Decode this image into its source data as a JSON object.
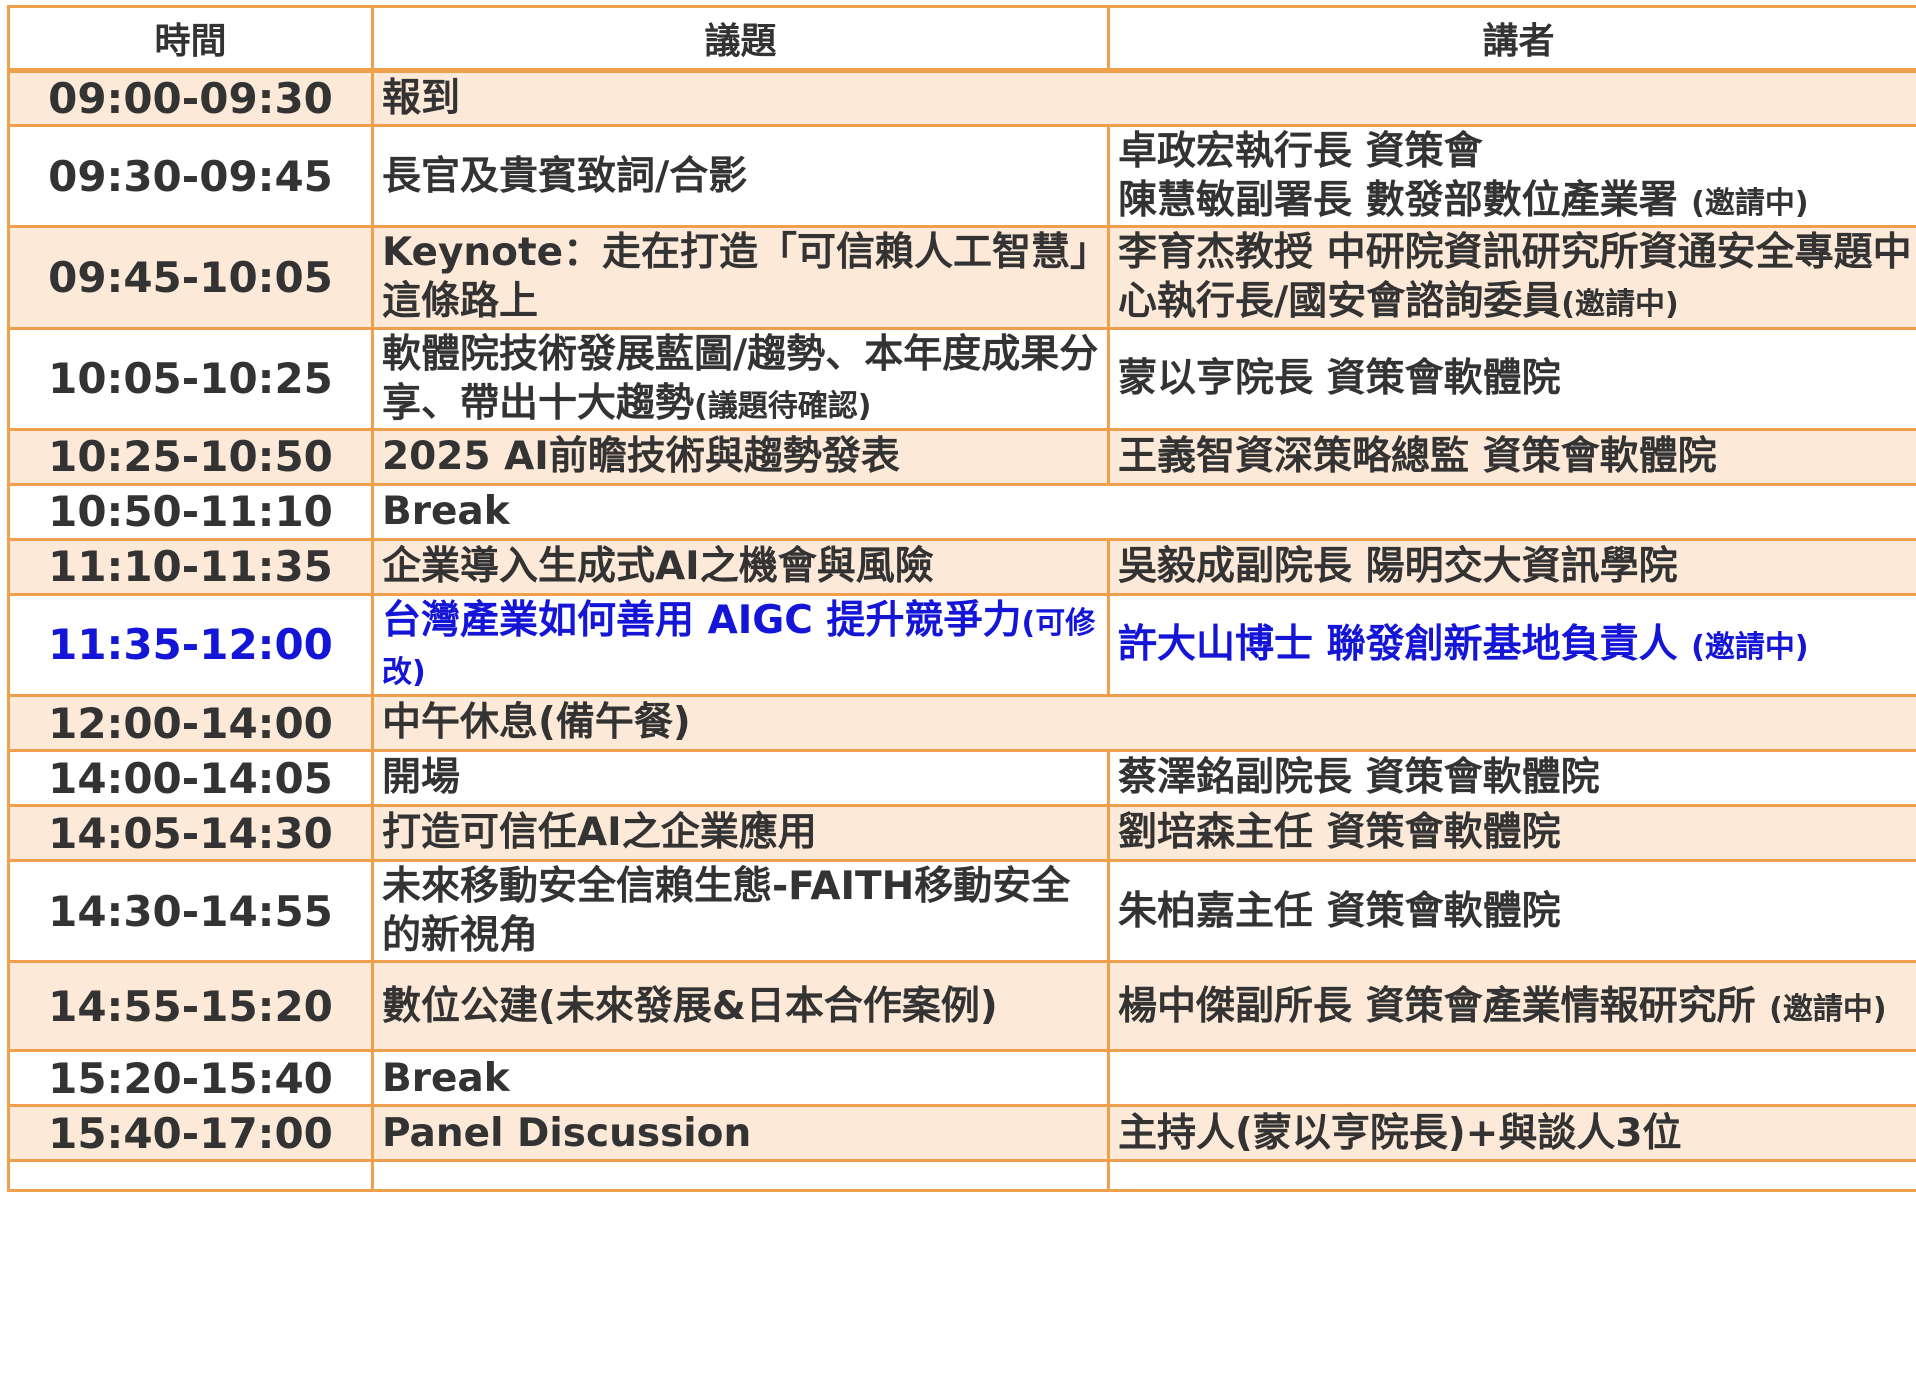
{
  "header": {
    "time": "時間",
    "topic": "議題",
    "speaker": "講者"
  },
  "rows": [
    {
      "time": "09:00-09:30",
      "topic": "報到",
      "speaker": []
    },
    {
      "time": "09:30-09:45",
      "topic": "長官及貴賓致詞/合影",
      "speaker": [
        {
          "text": "卓政宏執行長 資策會",
          "note": ""
        },
        {
          "text": "陳慧敏副署長 數發部數位產業署 ",
          "note": "(邀請中)"
        }
      ]
    },
    {
      "time": "09:45-10:05",
      "topic": "Keynote：走在打造「可信賴人工智慧」這條路上",
      "speaker": [
        {
          "text": "李育杰教授 中研院資訊研究所資通安全專題中心執行長/國安會諮詢委員",
          "note": "(邀請中)"
        }
      ]
    },
    {
      "time": "10:05-10:25",
      "topic": "軟體院技術發展藍圖/趨勢、本年度成果分享、帶出十大趨勢",
      "topic_note": "(議題待確認)",
      "speaker": [
        {
          "text": "蒙以亨院長 資策會軟體院",
          "note": ""
        }
      ]
    },
    {
      "time": "10:25-10:50",
      "topic": "2025 AI前瞻技術與趨勢發表",
      "speaker": [
        {
          "text": "王義智資深策略總監 資策會軟體院",
          "note": ""
        }
      ]
    },
    {
      "time": "10:50-11:10",
      "topic": "Break",
      "speaker": []
    },
    {
      "time": "11:10-11:35",
      "topic": "企業導入生成式AI之機會與風險",
      "speaker": [
        {
          "text": "吳毅成副院長 陽明交大資訊學院",
          "note": ""
        }
      ]
    },
    {
      "time": "11:35-12:00",
      "topic": "台灣產業如何善用 AIGC 提升競爭力",
      "topic_note": "(可修改)",
      "speaker": [
        {
          "text": "許大山博士 聯發創新基地負責人 ",
          "note": "(邀請中)"
        }
      ]
    },
    {
      "time": "12:00-14:00",
      "topic": "中午休息(備午餐)",
      "speaker": []
    },
    {
      "time": "14:00-14:05",
      "topic": "開場",
      "speaker": [
        {
          "text": "蔡澤銘副院長 資策會軟體院",
          "note": ""
        }
      ]
    },
    {
      "time": "14:05-14:30",
      "topic": "打造可信任AI之企業應用",
      "speaker": [
        {
          "text": "劉培森主任 資策會軟體院",
          "note": ""
        }
      ]
    },
    {
      "time": "14:30-14:55",
      "topic": "未來移動安全信賴生態-FAITH移動安全的新視角",
      "speaker": [
        {
          "text": "朱柏嘉主任 資策會軟體院",
          "note": ""
        }
      ]
    },
    {
      "time": "14:55-15:20",
      "topic": "數位公建(未來發展&日本合作案例)",
      "speaker": [
        {
          "text": "楊中傑副所長 資策會產業情報研究所 ",
          "note": "(邀請中)"
        }
      ]
    },
    {
      "time": "15:20-15:40",
      "topic": "Break",
      "speaker": []
    },
    {
      "time": "15:40-17:00",
      "topic": "Panel Discussion",
      "speaker": [
        {
          "text": "主持人(蒙以亨院長)+與談人3位",
          "note": ""
        }
      ]
    }
  ],
  "colors": {
    "border": "#F0A04C",
    "row_alt": "#FCE9D8",
    "highlight_text": "#1515D8",
    "text": "#333333"
  }
}
